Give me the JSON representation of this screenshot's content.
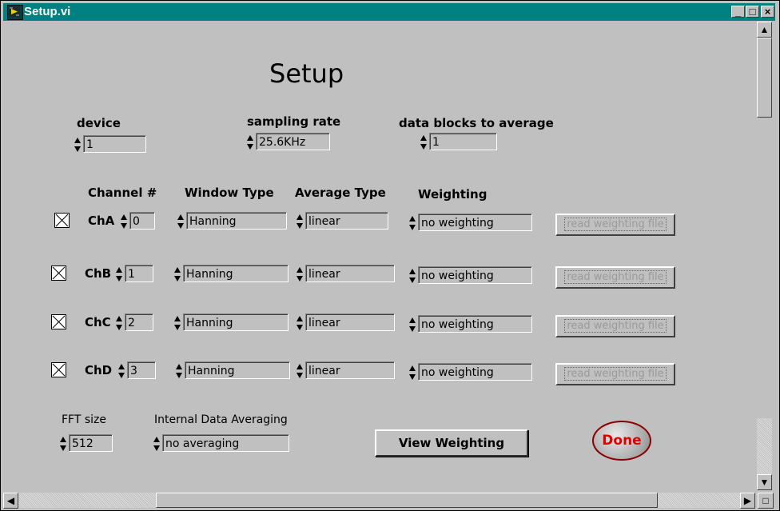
{
  "window": {
    "title": "Setup.vi"
  },
  "title_buttons": {
    "minimize": "_",
    "maximize": "□",
    "close": "×"
  },
  "heading": "Setup",
  "device": {
    "label": "device",
    "value": "1"
  },
  "sampling_rate": {
    "label": "sampling rate",
    "value": "25.6KHz"
  },
  "data_blocks": {
    "label": "data blocks to average",
    "value": "1"
  },
  "columns": {
    "channel": "Channel #",
    "window": "Window Type",
    "average": "Average Type",
    "weighting": "Weighting"
  },
  "channels": [
    {
      "checked": true,
      "name": "ChA",
      "number": "0",
      "window": "Hanning",
      "average": "linear",
      "weighting": "no weighting",
      "button": "read weighting file"
    },
    {
      "checked": true,
      "name": "ChB",
      "number": "1",
      "window": "Hanning",
      "average": "linear",
      "weighting": "no weighting",
      "button": "read weighting file"
    },
    {
      "checked": true,
      "name": "ChC",
      "number": "2",
      "window": "Hanning",
      "average": "linear",
      "weighting": "no weighting",
      "button": "read weighting file"
    },
    {
      "checked": true,
      "name": "ChD",
      "number": "3",
      "window": "Hanning",
      "average": "linear",
      "weighting": "no weighting",
      "button": "read weighting file"
    }
  ],
  "fft": {
    "label": "FFT size",
    "value": "512"
  },
  "internal_avg": {
    "label": "Internal Data Averaging",
    "value": "no averaging"
  },
  "view_weighting": "View Weighting",
  "done": "Done",
  "colors": {
    "titlebar": "#008080",
    "done_text": "#e00000",
    "panel": "#c0c0c0"
  }
}
